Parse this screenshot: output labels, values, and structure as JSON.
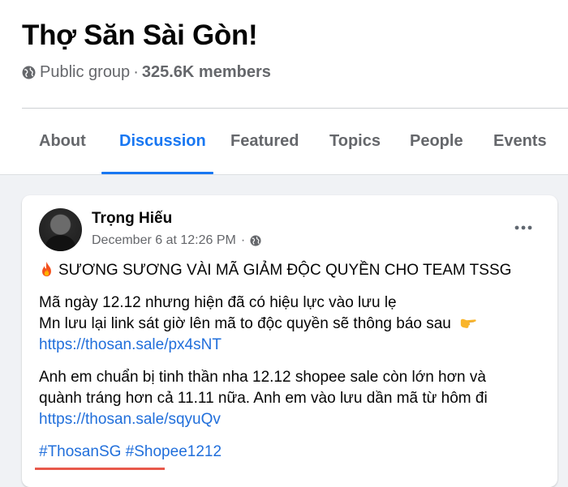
{
  "group": {
    "name": "Thợ Săn Sài Gòn!",
    "privacy": "Public group",
    "separator": "·",
    "members": "325.6K members"
  },
  "tabs": [
    "About",
    "Discussion",
    "Featured",
    "Topics",
    "People",
    "Events"
  ],
  "active_tab": "Discussion",
  "post": {
    "author": "Trọng Hiếu",
    "time": "December 6 at 12:26 PM",
    "time_separator": "·",
    "heading": "SƯƠNG SƯƠNG VÀI MÃ GIẢM ĐỘC QUYỀN CHO TEAM TSSG",
    "para1_line1": "Mã ngày 12.12 nhưng hiện đã có hiệu lực vào lưu lẹ",
    "para1_line2": "Mn lưu lại link sát giờ lên mã to độc quyền sẽ thông báo sau",
    "link1": "https://thosan.sale/px4sNT",
    "para2_line1": "Anh em chuẩn bị tinh thần nha 12.12 shopee sale còn lớn hơn và",
    "para2_line2": "quành tráng hơn cả 11.11 nữa. Anh em vào lưu dần mã từ hôm đi",
    "link2": "https://thosan.sale/sqyuQv",
    "hashtag1": "#ThosanSG",
    "hashtag2": "#Shopee1212"
  },
  "icons": {
    "globe": "globe-icon",
    "more": "more-options-icon",
    "fire": "fire-emoji",
    "pointing": "pointing-right-emoji"
  },
  "colors": {
    "accent": "#1877f2",
    "link": "#216fdb",
    "secondary_text": "#65676b",
    "background": "#f0f2f5"
  }
}
